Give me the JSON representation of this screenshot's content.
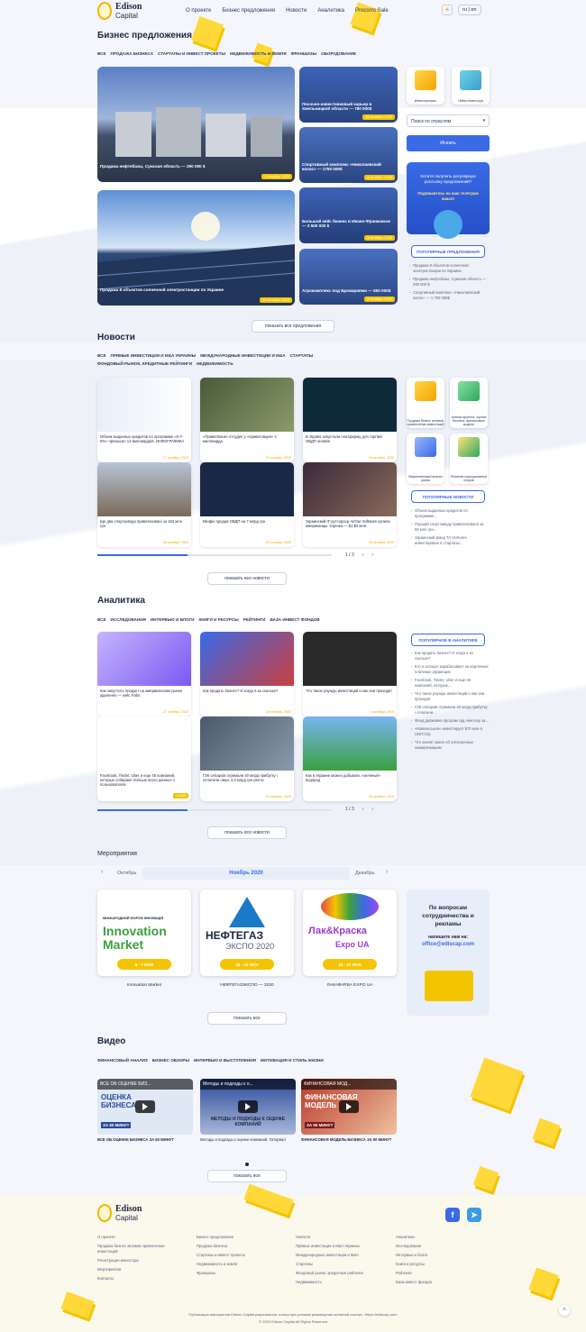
{
  "logo": {
    "name": "Edison",
    "sub": "Capital"
  },
  "nav": [
    "О проекте",
    "Бизнес предложения",
    "Новости",
    "Аналитика",
    "Procorro Sale"
  ],
  "lang": "ru | en",
  "biz": {
    "title": "Бизнес предложения",
    "tags": [
      "ВСЕ",
      "ПРОДАЖА БИЗНЕСА",
      "СТАРТАПЫ И ИНВЕСТ ПРОЕКТЫ",
      "НЕДВИЖИМОСТЬ И ЗЕМЛЯ",
      "ФРАНШИЗЫ",
      "ОБОРУДОВАНИЕ"
    ],
    "big": [
      {
        "title": "Продажа нефтебазы, Сумская область — 290 000 $",
        "date": "3 октября, 2020"
      },
      {
        "title": "Продажа 8 объектов солнечной электростанции по Украине",
        "date": "23 октября, 2020"
      }
    ],
    "small": [
      {
        "title": "Песочно-известняковый карьер в Хмельницкой области — 780 000$",
        "date": "16 октября, 2020"
      },
      {
        "title": "Спортивный комплекс «Николаевский колос» — 1750 000$",
        "date": "8 октября, 2020"
      },
      {
        "title": "Большой кейс бизнес в Ивано-Франковске — 3 500 000 $",
        "date": "8 октября, 2020"
      },
      {
        "title": "Агрокомплекс под Бровариями — 650 000$",
        "date": "6 октября, 2020"
      }
    ],
    "show_all": "показать все предложения",
    "side": {
      "invest": "Инвестировать",
      "find": "Найти инвестора",
      "select": "Поиск по отраслям",
      "search_btn": "Искать",
      "promo": "Хотите получить регулярную рассылку предложений?",
      "promo_link": "Подпишитесь на наш телеграм канал!",
      "popular": "ПОПУЛЯРНЫЕ ПРЕДЛОЖЕНИЯ",
      "list": [
        "Продажа 8 объектов солнечной электростанции по Украине",
        "Продажа нефтебазы, Сумская область — 290 000 $",
        "Спортивный комплекс «Николаевский колос» — 1 750 000$"
      ]
    }
  },
  "news": {
    "title": "Новости",
    "tags": [
      "ВСЕ",
      "ПРЯМЫЕ ИНВЕСТИЦИИ И M&A УКРАИНЫ",
      "МЕЖДУНАРОДНЫЕ ИНВЕСТИЦИИ И M&A",
      "СТАРТАПЫ",
      "ФОНДОВЫЙ РЫНОК, КРЕДИТНЫЕ РЕЙТИНГИ",
      "НЕДВИЖИМОСТЬ"
    ],
    "cards": [
      {
        "t": "Объем выданных кредитов по программе «5-7-9%» превысил 13 миллиардов. ИНФОГРАФИКА",
        "d": "17 октября, 2020"
      },
      {
        "t": "«ПриватБанк» отсудил у «приватовцев» 4 миллиарда",
        "d": "16 октября, 2020"
      },
      {
        "t": "В Україні запустили платформу для торгівлі ОВДП онлайн",
        "d": "16 октября, 2020"
      },
      {
        "t": "Ще два спортзавода приватизовані за 163 млн грн",
        "d": "26 октября, 2020"
      },
      {
        "t": "Мінфін продав ОВДП на 7 млрд грн",
        "d": "26 октября, 2020"
      },
      {
        "t": "Украинский IT-аутсорсер Archer Software купили американцы. Оценка — $1-$4 млн",
        "d": "26 октября, 2020"
      }
    ],
    "pager": "1 / 3",
    "show_all": "показать все новости",
    "side": {
      "items": [
        "Продажа бизнес активов, привлечение инвестиций",
        "Анализ проекта, оценка бизнеса, финансовые модели",
        "Маркетинговый анализ рынка",
        "Решение корпоративных споров"
      ],
      "popular": "ПОПУЛЯРНЫЕ НОВОСТИ",
      "list": [
        "Объем выданных кредитов по программе...",
        "Порший спортзаводу приватизовано за 55 млн грн...",
        "Украинский фонд TA Ventures инвестировал в стартапы..."
      ]
    }
  },
  "analytics": {
    "title": "Аналитика",
    "tags": [
      "ВСЕ",
      "ИССЛЕДОВАНИЯ",
      "ИНТЕРВЬЮ И БЛОГИ",
      "КНИГИ И РЕСУРСЫ",
      "РЕЙТИНГИ",
      "БАЗА ИНВЕСТ ФОНДОВ"
    ],
    "cards": [
      {
        "t": "Как запустить продукт на американском рынке удаленно — кейс Fabo",
        "d": "27 октября, 2020"
      },
      {
        "t": "Как продать бизнес? И когда я за сколько?",
        "d": "20 октября, 2020"
      },
      {
        "t": "Что такое раунды инвестиций и как они проходят",
        "d": "4 октября, 2020"
      },
      {
        "t": "Facebook, Tinder, Uber и еще 45 компаний, которые собирают больше всего данных о пользователях",
        "d": "1 НОЯ"
      },
      {
        "t": "ГЗК олігархів отримали 40 млрд прибутку і сплатили лише 3,3 млрд грн ренти",
        "d": "22 октября, 2020"
      },
      {
        "t": "Как в Украине можно добывать «зеленый» водород",
        "d": "28 октября, 2020"
      }
    ],
    "pager": "1 / 3",
    "show_all": "показать все новости",
    "popular": "ПОПУЛЯРНОЕ В АНАЛИТИКЕ",
    "list": [
      "Как продать бизнес? И когда я за сколько?",
      "Кто и сколько зарабатывает на карточных платежах украинцев",
      "Facebook, Tinder, Uber и еще 45 компаний, которые...",
      "Что такое раунды инвестиций и как они проходят",
      "ГЗК олігархів отримали 40 млрд прибутку і сплатили...",
      "Фонд державна програм суд Аметону за...",
      "«Ковальськая» инвестирует $70 млн в UNIT.City",
      "Что значит закон об электронных коммуникациях"
    ]
  },
  "events": {
    "title": "Мероприятия",
    "prev": "Октябрь",
    "current": "Ноябрь 2020",
    "next": "Декабрь",
    "cards": [
      {
        "name": "Innovation Market",
        "date": "5 - 7 НОЯ",
        "forum": "МІЖНАРОДНИЙ ФОРУМ ІННОВАЦІЙ",
        "logo1": "Innovation",
        "logo2": "Market"
      },
      {
        "name": "НЕФТЕГАЗЭКСПО — 2020",
        "date": "10 - 12 НОЯ",
        "logo1": "НЕФТЕГАЗ",
        "logo2": "ЭКСПО 2020"
      },
      {
        "name": "ЛАКАФАРБА EXPO UA",
        "date": "24 - 27 НОЯ",
        "logo1": "Лак&Краска",
        "logo2": "Expo UA"
      }
    ],
    "promo": {
      "line1": "По вопросам сотрудничества и рекламы",
      "line2": "напишите нам на:",
      "email": "office@ediscap.com"
    },
    "show_all": "показать все"
  },
  "video": {
    "title": "Видео",
    "tags": [
      "ФИНАНСОВЫЙ АНАЛИЗ",
      "БИЗНЕС ОБЗОРЫ",
      "ИНТЕРВЬЮ И ВЫСТУПЛЕНИЯ",
      "МОТИВАЦИЯ И СТИЛЬ ЖИЗНИ"
    ],
    "cards": [
      {
        "top": "ВСЕ ОБ ОЦЕНКЕ БИЗ...",
        "big": "ОЦЕНКА БИЗНЕСА",
        "small": "ЗА 60 МИНУТ",
        "t": "ВСЕ ОБ ОЦЕНКЕ БИЗНЕСА ЗА 60 МИНУТ"
      },
      {
        "top": "Методы и подходы к о...",
        "big": "МЕТОДЫ И ПОДХОДЫ К ОЦЕНКЕ КОМПАНИЙ",
        "small": "",
        "t": "Методы и подходы к оценке компаний. Титорнал"
      },
      {
        "top": "ФИНАНСОВАЯ МОД...",
        "big": "ФИНАНСОВАЯ МОДЕЛЬ",
        "small": "ЗА 90 МИНУТ",
        "t": "ФИНАНСОВАЯ МОДЕЛЬ БИЗНЕСА ЗА 90 МИНУТ"
      }
    ],
    "show_all": "показать все"
  },
  "footer": {
    "cols": [
      [
        "О проекте",
        "Продажа бизнес активов привлечение инвестиций",
        "Регистрация инвестора",
        "Мероприятия",
        "Контакты"
      ],
      [
        "Бизнес предложения",
        "Продажа бизнеса",
        "Стартапы и инвест проекты",
        "Недвижимость и земля",
        "Франшизы"
      ],
      [
        "Новости",
        "Прямые инвестиции и M&A Украины",
        "Международные инвестиции и M&A",
        "Стартапы",
        "Фондовый рынок, кредитные рейтинги",
        "Недвижимость"
      ],
      [
        "Аналитика",
        "Исследования",
        "Интервью и блоги",
        "Книги и ресурсы",
        "Рейтинги",
        "База инвест фондов"
      ]
    ],
    "copy1": "Публикация материалов Edison Capital разрешается только при условии размещения активной ссылки - https://ediscap.com/",
    "copy2": "© 2020 Edison Capital All Rights Reserved"
  },
  "colors": {
    "accent": "#3a6ae6",
    "yellow": "#f5c400",
    "navy": "#1d2544"
  }
}
